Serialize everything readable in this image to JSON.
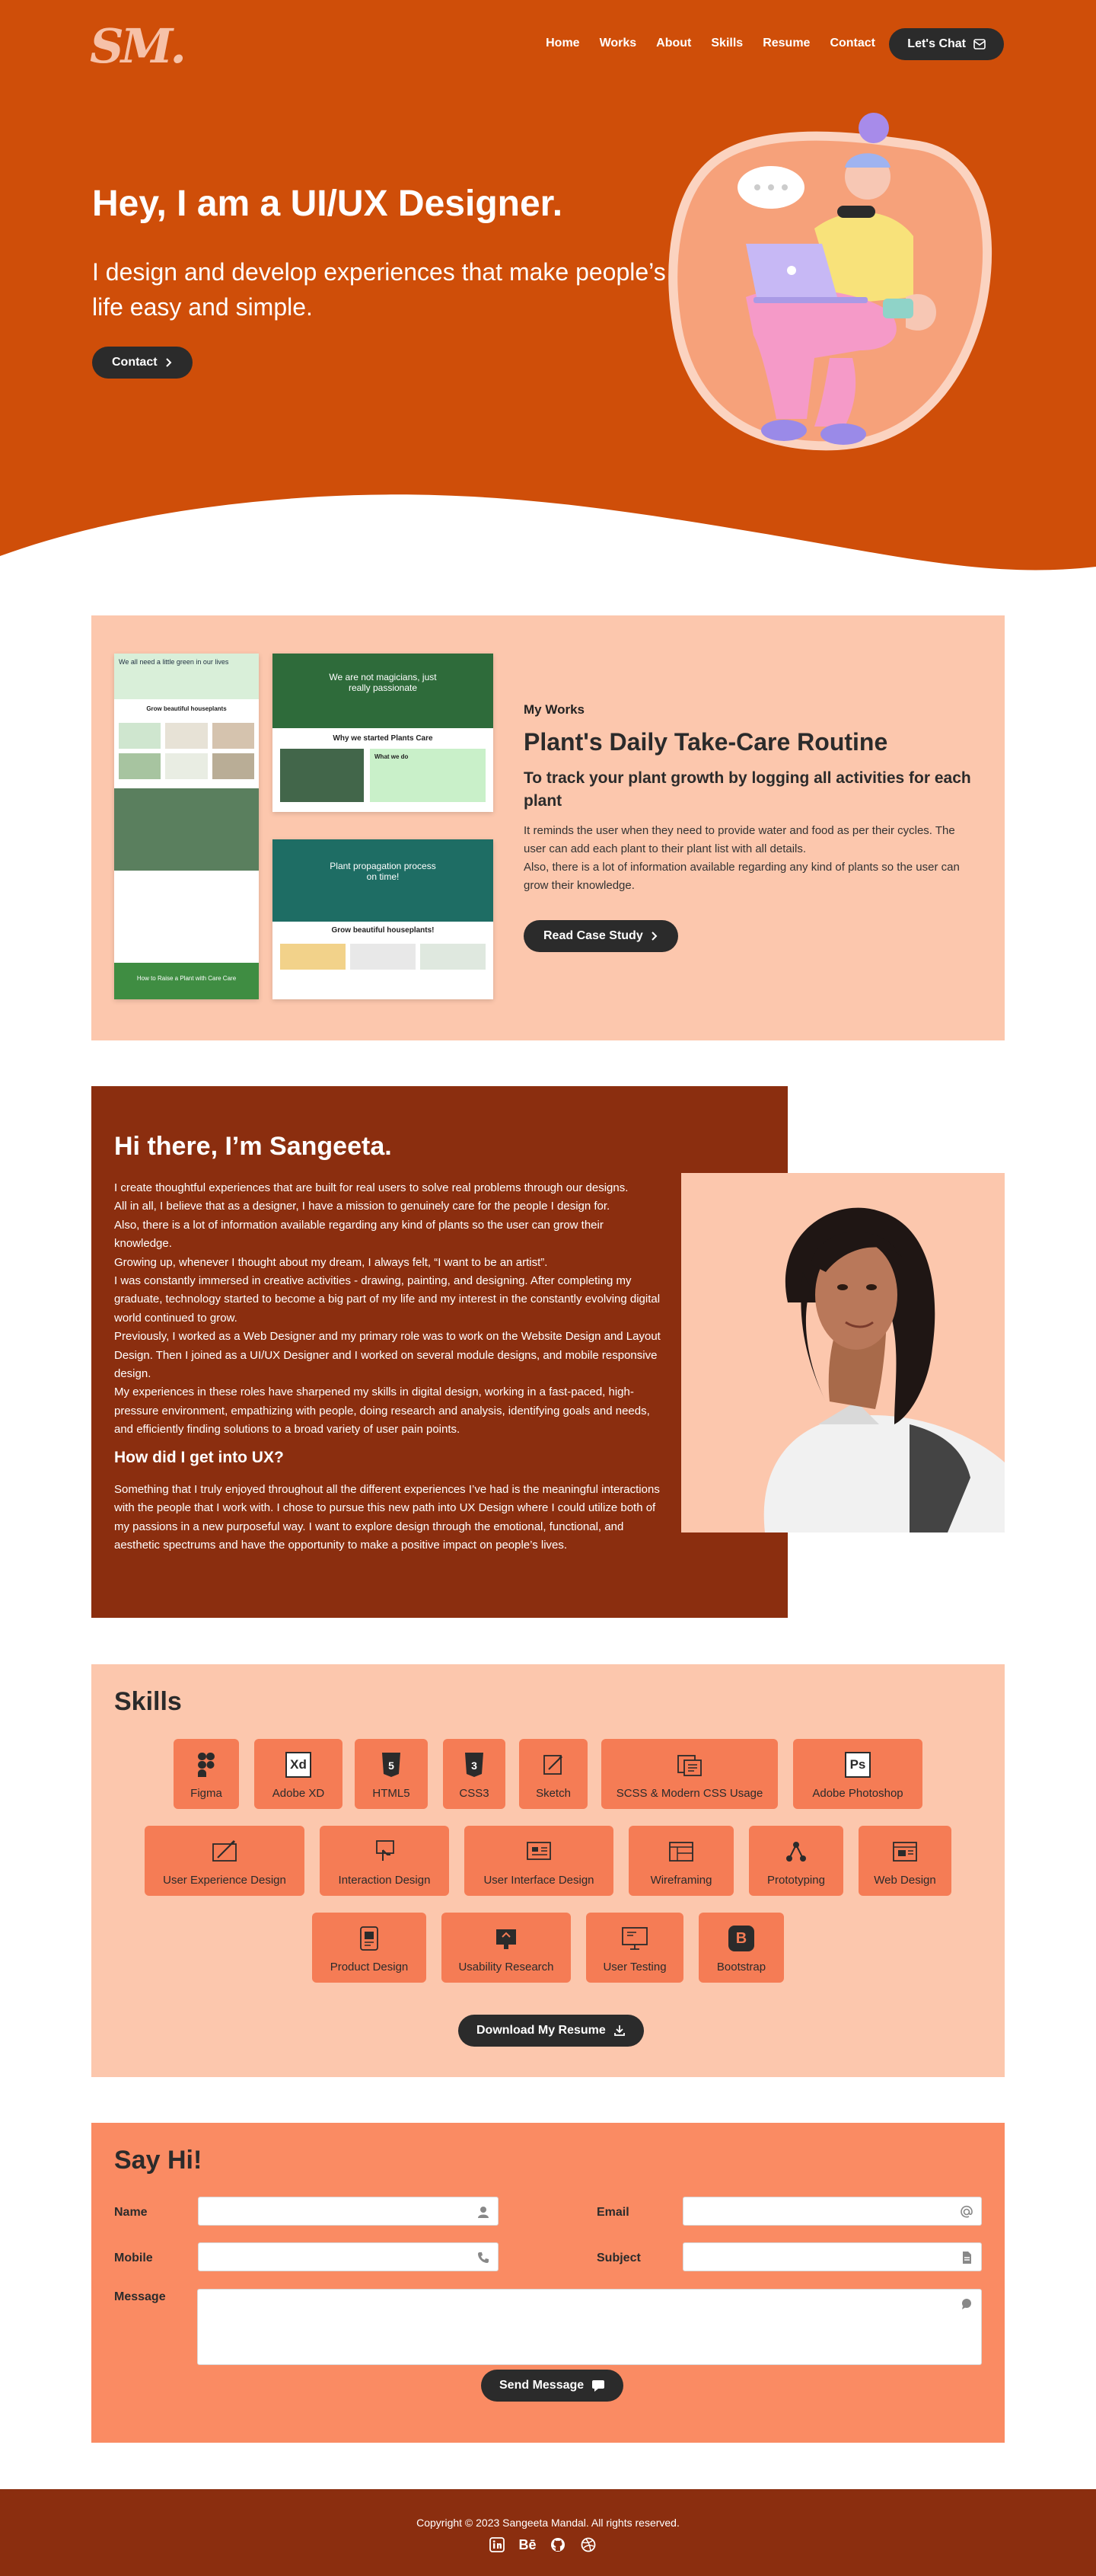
{
  "nav": {
    "logo": "SM",
    "links": [
      "Home",
      "Works",
      "About",
      "Skills",
      "Resume",
      "Contact"
    ],
    "chat_label": "Let's Chat"
  },
  "hero": {
    "title": "Hey, I am a UI/UX Designer.",
    "subtitle": "I design and develop experiences that make people’s life easy and simple.",
    "contact_label": "Contact"
  },
  "works": {
    "eyebrow": "My Works",
    "title": "Plant's Daily Take-Care Routine",
    "subtitle": "To track your plant growth by logging all activities for each plant",
    "desc1": "It reminds the user when they need to provide water and food as per their cycles. The user can add each plant to their plant list with all details.",
    "desc2": "Also, there is a lot of information available regarding any kind of plants so the user can grow their knowledge.",
    "cta": "Read Case Study",
    "mock1_heading": "We all need a little green in our lives",
    "mock1_section": "Grow beautiful houseplants",
    "mock1_footer": "How to Raise a Plant with Care Care",
    "mock2_heading": "We are not magicians, just really passionate",
    "mock2_section": "Why we started Plants Care",
    "mock2_what": "What we do",
    "mock3_heading": "Plant propagation process on time!",
    "mock3_section": "Grow beautiful houseplants!"
  },
  "about": {
    "title": "Hi there, I’m Sangeeta.",
    "lines": [
      "I create thoughtful experiences that are built for real users to solve real problems through our designs.",
      "All in all, I believe that as a designer, I have a mission to genuinely care for the people I design for.",
      "Also, there is a lot of information available regarding any kind of plants so the user can grow their knowledge.",
      "Growing up, whenever I thought about my dream, I always felt, “I want to be an artist”.",
      "I was constantly immersed in creative activities - drawing, painting, and designing. After completing my graduate, technology started to become a big part of my life and my interest in the constantly evolving digital world continued to grow.",
      "Previously, I worked as a Web Designer and my primary role was to work on the Website Design and Layout Design. Then I joined as a UI/UX Designer and I worked on several module designs, and mobile responsive design.",
      "My experiences in these roles have sharpened my skills in digital design, working in a fast-paced, high-pressure environment, empathizing with people, doing research and analysis, identifying goals and needs, and efficiently finding solutions to a broad variety of user pain points."
    ],
    "subtitle": "How did I get into UX?",
    "body2": "Something that I truly enjoyed throughout all the different experiences I’ve had is the meaningful interactions with the people that I work with. I chose to pursue this new path into UX Design where I could utilize both of my passions in a new purposeful way. I want to explore design through the emotional, functional, and aesthetic spectrums and have the opportunity to make a positive impact on people’s lives."
  },
  "skills": {
    "title": "Skills",
    "items": [
      {
        "label": "Figma",
        "icon": "figma-icon"
      },
      {
        "label": "Adobe XD",
        "icon": "adobe-xd-icon"
      },
      {
        "label": "HTML5",
        "icon": "html5-icon"
      },
      {
        "label": "CSS3",
        "icon": "css3-icon"
      },
      {
        "label": "Sketch",
        "icon": "sketch-icon"
      },
      {
        "label": "SCSS & Modern CSS Usage",
        "icon": "scss-icon"
      },
      {
        "label": "Adobe Photoshop",
        "icon": "photoshop-icon"
      },
      {
        "label": "User Experience Design",
        "icon": "ux-design-icon"
      },
      {
        "label": "Interaction Design",
        "icon": "interaction-icon"
      },
      {
        "label": "User Interface Design",
        "icon": "ui-design-icon"
      },
      {
        "label": "Wireframing",
        "icon": "wireframe-icon"
      },
      {
        "label": "Prototyping",
        "icon": "prototype-icon"
      },
      {
        "label": "Web Design",
        "icon": "web-design-icon"
      },
      {
        "label": "Product Design",
        "icon": "product-design-icon"
      },
      {
        "label": "Usability Research",
        "icon": "research-icon"
      },
      {
        "label": "User Testing",
        "icon": "user-testing-icon"
      },
      {
        "label": "Bootstrap",
        "icon": "bootstrap-icon"
      }
    ],
    "download_label": "Download My Resume",
    "icon_letters": {
      "xd": "Xd",
      "ps": "Ps",
      "html": "5",
      "css": "3",
      "bs": "B"
    }
  },
  "contact": {
    "title": "Say Hi!",
    "name_label": "Name",
    "email_label": "Email",
    "mobile_label": "Mobile",
    "subject_label": "Subject",
    "message_label": "Message",
    "send_label": "Send Message"
  },
  "footer": {
    "copyright": "Copyright © 2023 Sangeeta Mandal. All rights reserved.",
    "social": [
      "linkedin-icon",
      "behance-icon",
      "github-icon",
      "dribbble-icon"
    ],
    "behance_text": "Bē"
  },
  "colors": {
    "hero_orange": "#cf4e09",
    "peach": "#fcc7ad",
    "coral": "#fa8b63",
    "chip": "#f57c55",
    "maroon": "#8b2e0f",
    "dark": "#2b2b2b"
  }
}
